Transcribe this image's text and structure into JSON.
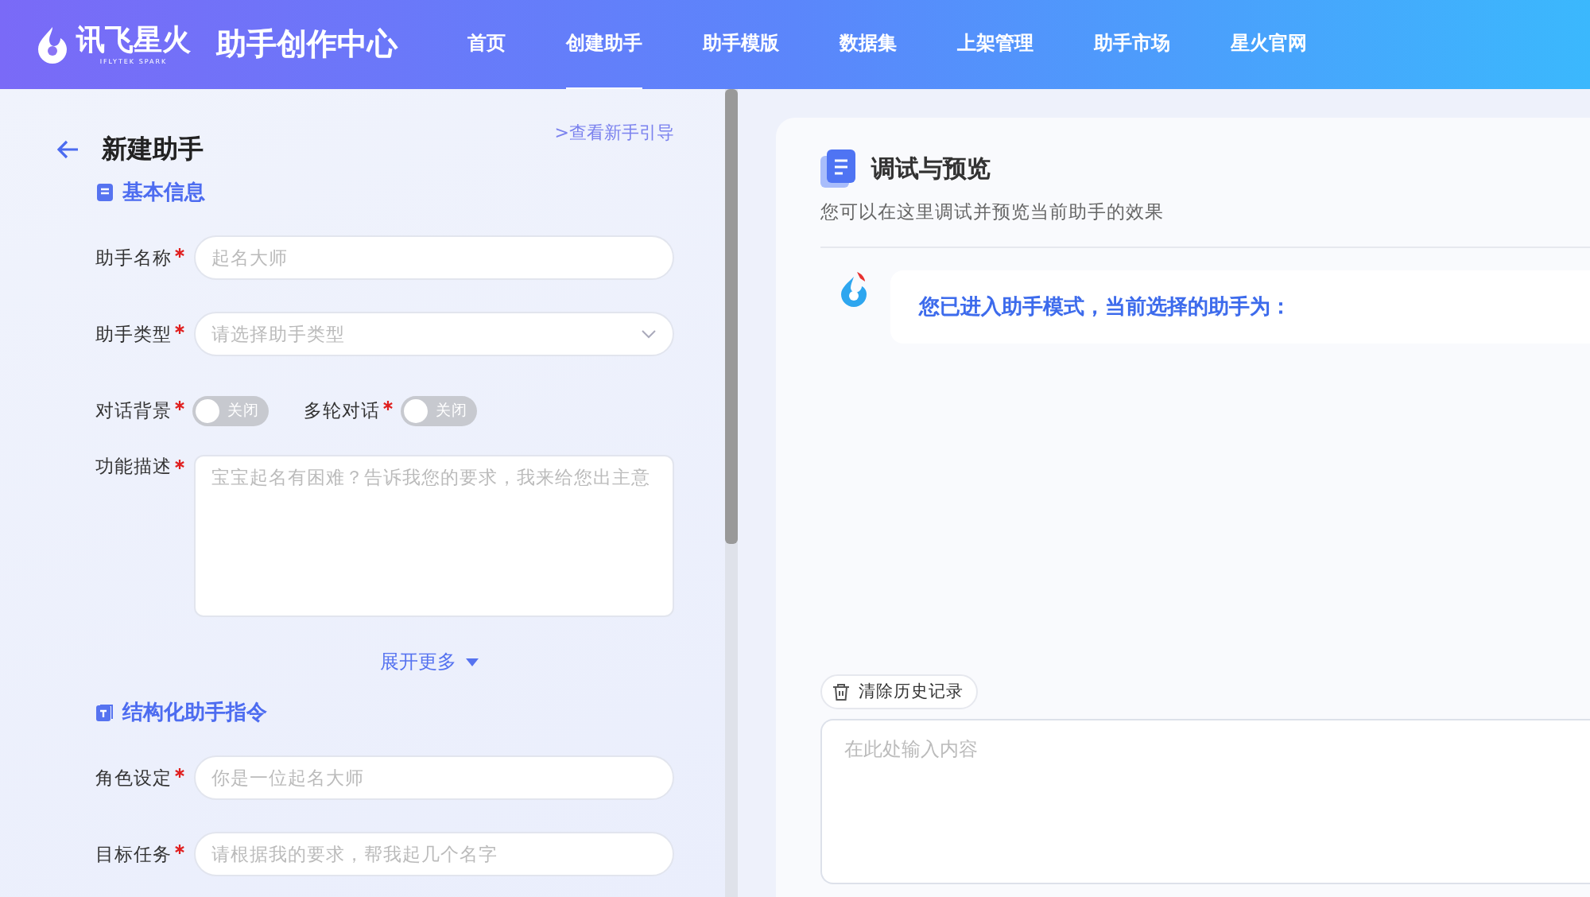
{
  "header": {
    "logo": "讯飞星火",
    "logo_sub": "IFLYTEK SPARK",
    "title": "助手创作中心",
    "nav": [
      {
        "label": "首页",
        "selected": false
      },
      {
        "label": "创建助手",
        "selected": true
      },
      {
        "label": "助手模版",
        "selected": false
      },
      {
        "label": "数据集",
        "selected": false
      },
      {
        "label": "上架管理",
        "selected": false
      },
      {
        "label": "助手市场",
        "selected": false
      },
      {
        "label": "星火官网",
        "selected": false
      }
    ]
  },
  "form": {
    "title": "新建助手",
    "guide_link": ">查看新手引导",
    "basic_info": {
      "title": "基本信息",
      "fields": [
        {
          "kind": "text",
          "label": "助手名称",
          "required": true,
          "placeholder": "起名大师"
        },
        {
          "kind": "select",
          "label": "助手类型",
          "required": true,
          "placeholder": "请选择助手类型"
        },
        {
          "kind": "toggles",
          "toggles": [
            {
              "label": "对话背景",
              "required": true,
              "on": false,
              "text": "关闭"
            },
            {
              "label": "多轮对话",
              "required": true,
              "on": false,
              "text": "关闭"
            }
          ]
        },
        {
          "kind": "textarea",
          "label": "功能描述",
          "required": true,
          "placeholder": "宝宝起名有困难？告诉我您的要求，我来给您出主意"
        }
      ]
    },
    "expand_more": "展开更多",
    "structured": {
      "title": "结构化助手指令",
      "fields": [
        {
          "kind": "text",
          "label": "角色设定",
          "required": true,
          "placeholder": "你是一位起名大师"
        },
        {
          "kind": "text",
          "label": "目标任务",
          "required": true,
          "placeholder": "请根据我的要求，帮我起几个名字"
        }
      ]
    }
  },
  "preview": {
    "title": "调试与预览",
    "subtitle": "您可以在这里调试并预览当前助手的效果",
    "message": "您已进入助手模式，当前选择的助手为：",
    "clear_history": "清除历史记录",
    "input_placeholder": "在此处输入内容"
  }
}
